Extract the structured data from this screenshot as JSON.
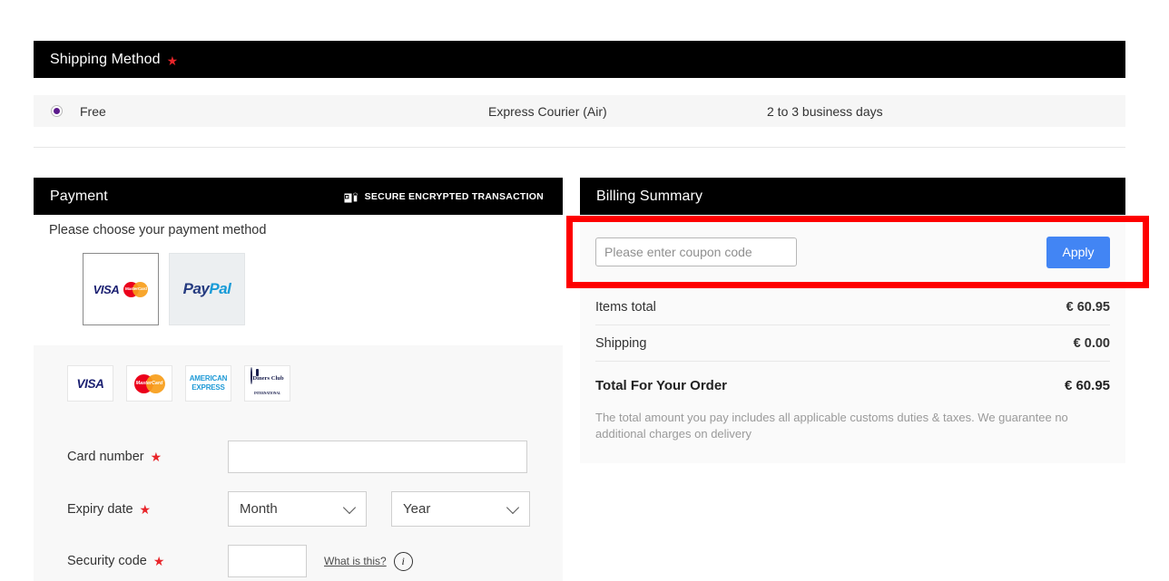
{
  "shipping": {
    "header_title": "Shipping Method",
    "required_marker": "★",
    "option": {
      "name": "Free",
      "service": "Express Courier (Air)",
      "eta": "2 to 3 business days",
      "selected": true
    }
  },
  "payment": {
    "header_title": "Payment",
    "secure_badge": {
      "icon": "lock-icon",
      "label": "SECURE ENCRYPTED TRANSACTION"
    },
    "choose_text": "Please choose your payment method",
    "methods": [
      {
        "id": "card",
        "label": "VISA MasterCard",
        "selected": true
      },
      {
        "id": "paypal",
        "label": "PayPal",
        "selected": false
      }
    ],
    "paypal_part1": "Pay",
    "paypal_part2": "Pal",
    "visa_label": "VISA",
    "mastercard_label": "MasterCard",
    "accepted_brands": [
      {
        "id": "visa",
        "label": "VISA"
      },
      {
        "id": "mastercard",
        "label": "MasterCard"
      },
      {
        "id": "amex",
        "line1": "AMERICAN",
        "line2": "EXPRESS"
      },
      {
        "id": "diners",
        "line1": "Diners Club",
        "line2": "INTERNATIONAL"
      }
    ],
    "fields": {
      "card_number_label": "Card number",
      "card_number_value": "",
      "card_number_placeholder": "",
      "expiry_label": "Expiry date",
      "month_value": "Month",
      "year_value": "Year",
      "security_label": "Security code",
      "security_value": "",
      "security_placeholder": "",
      "what_is_this": "What is this?",
      "info_glyph": "i"
    }
  },
  "billing": {
    "header_title": "Billing Summary",
    "coupon_placeholder": "Please enter coupon code",
    "coupon_value": "",
    "apply_label": "Apply",
    "lines": [
      {
        "label": "Items total",
        "amount": "€ 60.95"
      },
      {
        "label": "Shipping",
        "amount": "€ 0.00"
      }
    ],
    "total_label": "Total For Your Order",
    "total_amount": "€ 60.95",
    "disclaimer": "The total amount you pay includes all applicable customs duties & taxes. We guarantee no additional charges on delivery"
  },
  "colors": {
    "header_bg": "#000000",
    "accent_blue": "#4285f4",
    "required_red": "#e8252a",
    "highlight_red": "#fe0000",
    "radio_purple": "#5b1a8c"
  }
}
